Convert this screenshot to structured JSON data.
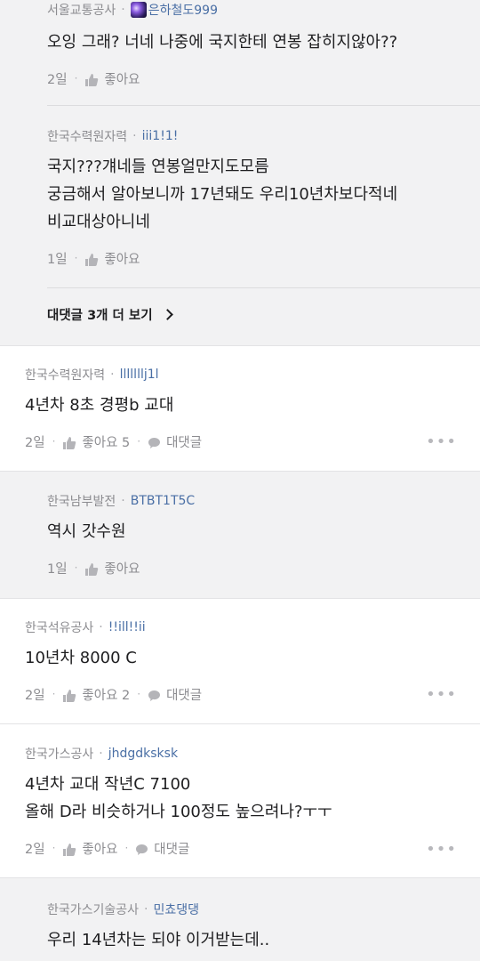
{
  "comments": [
    {
      "company": "서울교통공사",
      "nickname": "은하철도999",
      "avatar_icon": "galaxy-avatar-icon",
      "lines": [
        "오잉 그래? 너네 나중에 국지한테 연봉 잡히지않아??"
      ],
      "time": "2일",
      "like_label": "좋아요",
      "is_reply": true
    },
    {
      "company": "한국수력원자력",
      "nickname": "iii1!1!",
      "lines": [
        "국지???걔네들 연봉얼만지도모름",
        "궁금해서 알아보니까 17년돼도 우리10년차보다적네",
        "비교대상아니네"
      ],
      "time": "1일",
      "like_label": "좋아요",
      "is_reply": true
    },
    {
      "company": "한국수력원자력",
      "nickname": "lllllllj1l",
      "lines": [
        "4년차 8초 경평b 교대"
      ],
      "time": "2일",
      "like_label": "좋아요 5",
      "reply_label": "대댓글",
      "is_reply": false
    },
    {
      "company": "한국남부발전",
      "nickname": "BTBT1T5C",
      "lines": [
        "역시 갓수원"
      ],
      "time": "1일",
      "like_label": "좋아요",
      "is_reply": true
    },
    {
      "company": "한국석유공사",
      "nickname": "!!ill!!ii",
      "lines": [
        "10년차 8000 C"
      ],
      "time": "2일",
      "like_label": "좋아요 2",
      "reply_label": "대댓글",
      "is_reply": false
    },
    {
      "company": "한국가스공사",
      "nickname": "jhdgdksksk",
      "lines": [
        "4년차 교대 작년C 7100",
        "올해 D라 비슷하거나 100정도 높으려나?ㅜㅜ"
      ],
      "time": "2일",
      "like_label": "좋아요",
      "reply_label": "대댓글",
      "is_reply": false
    },
    {
      "company": "한국가스기술공사",
      "nickname": "민쵸댕댕",
      "lines": [
        "우리 14년차는 되야 이거받는데.."
      ],
      "is_reply": true
    }
  ],
  "more_replies_label": "대댓글 3개 더 보기",
  "more_dots": "•••",
  "colors": {
    "nickname": "#4a6fa5",
    "reply_bg": "#f2f2f3",
    "meta": "#8c8c90"
  }
}
